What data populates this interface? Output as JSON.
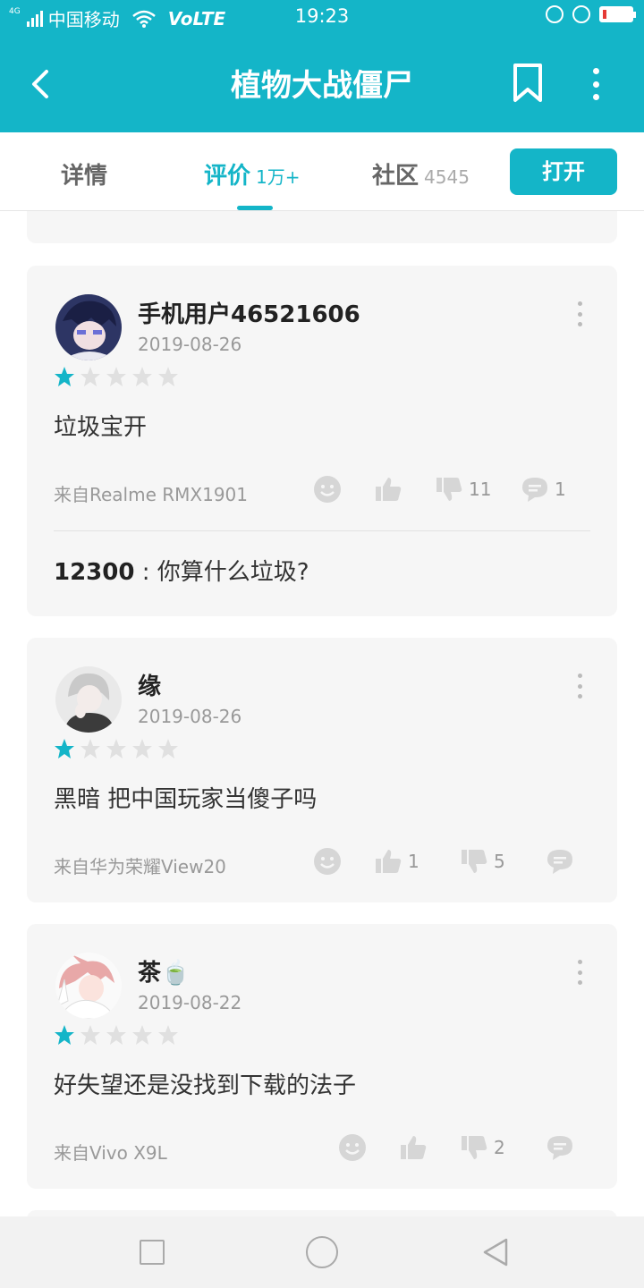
{
  "status": {
    "carrier": "中国移动",
    "volte": "VoLTE",
    "time": "19:23",
    "network": "4G"
  },
  "header": {
    "title": "植物大战僵尸"
  },
  "tabs": [
    {
      "label": "详情"
    },
    {
      "label": "评价",
      "count": "1万+"
    },
    {
      "label": "社区",
      "count": "4545"
    }
  ],
  "open_button": "打开",
  "reviews": [
    {
      "user": "手机用户46521606",
      "date": "2019-08-26",
      "rating": 1,
      "text": "垃圾宝开",
      "source": "来自Realme RMX1901",
      "likes": "",
      "dislikes": "11",
      "comments": "1",
      "reply": {
        "user": "12300",
        "text": " : 你算什么垃圾?"
      }
    },
    {
      "user": "缘",
      "date": "2019-08-26",
      "rating": 1,
      "text": "黑暗 把中国玩家当傻子吗",
      "source": "来自华为荣耀View20",
      "likes": "1",
      "dislikes": "5",
      "comments": ""
    },
    {
      "user": "茶🍵",
      "date": "2019-08-22",
      "rating": 1,
      "text": "好失望还是没找到下载的法子",
      "source": "来自Vivo X9L",
      "likes": "",
      "dislikes": "2",
      "comments": ""
    }
  ],
  "colors": {
    "accent": "#14b5c8",
    "card_bg": "#f6f6f6",
    "star_empty": "#e0e0e0"
  }
}
